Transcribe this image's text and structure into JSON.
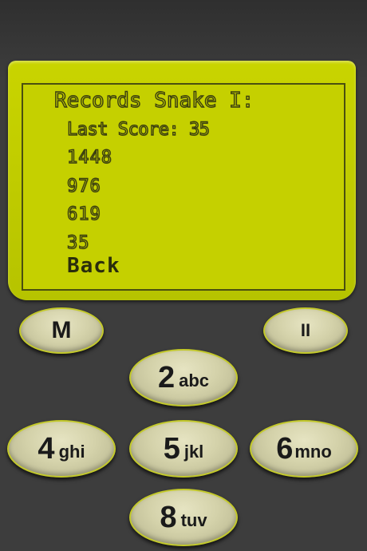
{
  "screen": {
    "title": "Records Snake I:",
    "last_score": "Last Score: 35",
    "records": [
      "1448",
      "976",
      "619",
      "35"
    ],
    "back_label": "Back"
  },
  "keys": {
    "menu": "M",
    "pause": "II",
    "k2": {
      "digit": "2",
      "letters": "abc"
    },
    "k4": {
      "digit": "4",
      "letters": "ghi"
    },
    "k5": {
      "digit": "5",
      "letters": "jkl"
    },
    "k6": {
      "digit": "6",
      "letters": "mno"
    },
    "k8": {
      "digit": "8",
      "letters": "tuv"
    }
  },
  "colors": {
    "lcd": "#c5d000",
    "body": "#3d3d3d",
    "key": "#d4d2aa"
  }
}
